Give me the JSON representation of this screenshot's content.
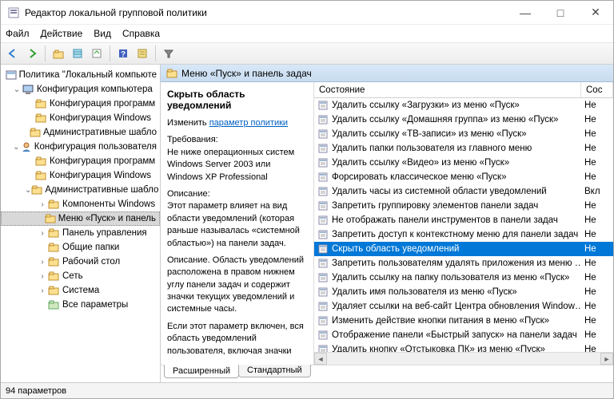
{
  "window": {
    "title": "Редактор локальной групповой политики",
    "min": "—",
    "max": "□",
    "close": "✕"
  },
  "menus": [
    "Файл",
    "Действие",
    "Вид",
    "Справка"
  ],
  "tree": {
    "root": "Политика \"Локальный компьюте",
    "nodes": [
      {
        "d": 0,
        "e": "v",
        "i": "comp",
        "t": "Конфигурация компьютера"
      },
      {
        "d": 1,
        "e": "",
        "i": "f",
        "t": "Конфигурация программ"
      },
      {
        "d": 1,
        "e": "",
        "i": "f",
        "t": "Конфигурация Windows"
      },
      {
        "d": 1,
        "e": "",
        "i": "f",
        "t": "Административные шабло"
      },
      {
        "d": 0,
        "e": "v",
        "i": "user",
        "t": "Конфигурация пользователя"
      },
      {
        "d": 1,
        "e": "",
        "i": "f",
        "t": "Конфигурация программ"
      },
      {
        "d": 1,
        "e": "",
        "i": "f",
        "t": "Конфигурация Windows"
      },
      {
        "d": 1,
        "e": "v",
        "i": "f",
        "t": "Административные шабло"
      },
      {
        "d": 2,
        "e": ">",
        "i": "f",
        "t": "Компоненты Windows"
      },
      {
        "d": 2,
        "e": "",
        "i": "f",
        "t": "Меню «Пуск» и панель",
        "sel": true
      },
      {
        "d": 2,
        "e": ">",
        "i": "f",
        "t": "Панель управления"
      },
      {
        "d": 2,
        "e": "",
        "i": "f",
        "t": "Общие папки"
      },
      {
        "d": 2,
        "e": ">",
        "i": "f",
        "t": "Рабочий стол"
      },
      {
        "d": 2,
        "e": ">",
        "i": "f",
        "t": "Сеть"
      },
      {
        "d": 2,
        "e": ">",
        "i": "f",
        "t": "Система"
      },
      {
        "d": 2,
        "e": "",
        "i": "fall",
        "t": "Все параметры"
      }
    ]
  },
  "path_header": "Меню «Пуск» и панель задач",
  "desc": {
    "title": "Скрыть область уведомлений",
    "edit_prefix": "Изменить",
    "edit_link": "параметр политики",
    "req_h": "Требования:",
    "req_t": "Не ниже операционных систем Windows Server 2003 или Windows XP Professional",
    "desc_h": "Описание:",
    "desc_t1": "Этот параметр влияет на вид области уведомлений (которая раньше называлась «системной областью») на панели задач.",
    "desc_t2": "Описание. Область уведомлений расположена в правом нижнем углу панели задач и содержит значки текущих уведомлений и системные часы.",
    "desc_t3": "Если этот параметр включен, вся область уведомлений пользователя, включая значки"
  },
  "list": {
    "col1": "Состояние",
    "col2": "Сос",
    "rows": [
      {
        "t": "Удалить ссылку «Загрузки» из меню «Пуск»",
        "s": "Не"
      },
      {
        "t": "Удалить ссылку «Домашняя группа» из меню «Пуск»",
        "s": "Не"
      },
      {
        "t": "Удалить ссылку «ТВ-записи» из меню «Пуск»",
        "s": "Не"
      },
      {
        "t": "Удалить папки пользователя из главного меню",
        "s": "Не"
      },
      {
        "t": "Удалить ссылку «Видео» из меню «Пуск»",
        "s": "Не"
      },
      {
        "t": "Форсировать классическое меню «Пуск»",
        "s": "Не"
      },
      {
        "t": "Удалить часы из системной области уведомлений",
        "s": "Вкл"
      },
      {
        "t": "Запретить группировку элементов панели задач",
        "s": "Не"
      },
      {
        "t": "Не отображать панели инструментов в панели задач",
        "s": "Не"
      },
      {
        "t": "Запретить доступ к контекстному меню для панели задач",
        "s": "Не"
      },
      {
        "t": "Скрыть область уведомлений",
        "s": "Не",
        "sel": true
      },
      {
        "t": "Запретить пользователям удалять приложения из меню …",
        "s": "Не"
      },
      {
        "t": "Удалить ссылку на папку пользователя из меню «Пуск»",
        "s": "Не"
      },
      {
        "t": "Удалить имя пользователя из меню «Пуск»",
        "s": "Не"
      },
      {
        "t": "Удаляет ссылки на веб-сайт Центра обновления Window…",
        "s": "Не"
      },
      {
        "t": "Изменить действие кнопки питания в меню «Пуск»",
        "s": "Не"
      },
      {
        "t": "Отображение панели «Быстрый запуск» на панели задач",
        "s": "Не"
      },
      {
        "t": "Удалить кнопку «Отстыковка ПК» из меню «Пуск»",
        "s": "Не"
      }
    ]
  },
  "tabs": {
    "ext": "Расширенный",
    "std": "Стандартный"
  },
  "status": "94 параметров"
}
